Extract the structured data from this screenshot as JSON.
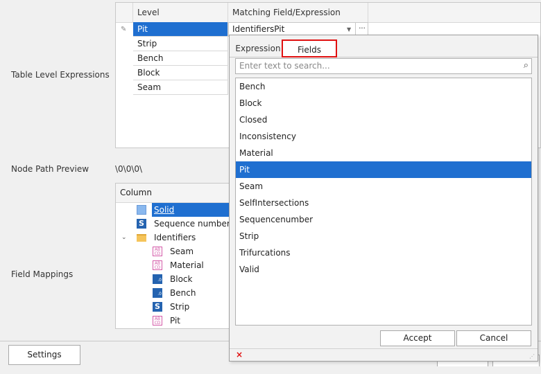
{
  "labels": {
    "table_level": "Table Level Expressions",
    "node_path": "Node Path Preview",
    "node_path_value": "\\0\\0\\0\\",
    "field_mappings": "Field Mappings"
  },
  "level_table": {
    "headers": [
      "Level",
      "Matching Field/Expression"
    ],
    "rows": [
      "Pit",
      "Strip",
      "Bench",
      "Block",
      "Seam"
    ],
    "editor_value": "IdentifiersPit",
    "ellipsis": "···"
  },
  "column_tree": {
    "header": "Column",
    "items": [
      {
        "label": "Solid",
        "icon": "solid-icon"
      },
      {
        "label": "Sequence number",
        "icon": "s-icon"
      },
      {
        "label": "Identifiers",
        "icon": "folder-icon"
      },
      {
        "label": "Seam",
        "icon": "abc-icon"
      },
      {
        "label": "Material",
        "icon": "abc-icon"
      },
      {
        "label": "Block",
        "icon": "numeric-icon"
      },
      {
        "label": "Bench",
        "icon": "numeric-icon"
      },
      {
        "label": "Strip",
        "icon": "s-icon"
      },
      {
        "label": "Pit",
        "icon": "abc-icon"
      }
    ]
  },
  "popup": {
    "tabs": [
      "Expression",
      "Fields"
    ],
    "active_tab": "Fields",
    "search_placeholder": "Enter text to search...",
    "fields": [
      "Bench",
      "Block",
      "Closed",
      "Inconsistency",
      "Material",
      "Pit",
      "Seam",
      "SelfIntersections",
      "Sequencenumber",
      "Strip",
      "Trifurcations",
      "Valid"
    ],
    "selected_field": "Pit",
    "accept": "Accept",
    "cancel": "Cancel",
    "close_glyph": "×"
  },
  "settings_button": "Settings",
  "colors": {
    "selection": "#1f6fd0",
    "highlight_border": "#e01010"
  }
}
